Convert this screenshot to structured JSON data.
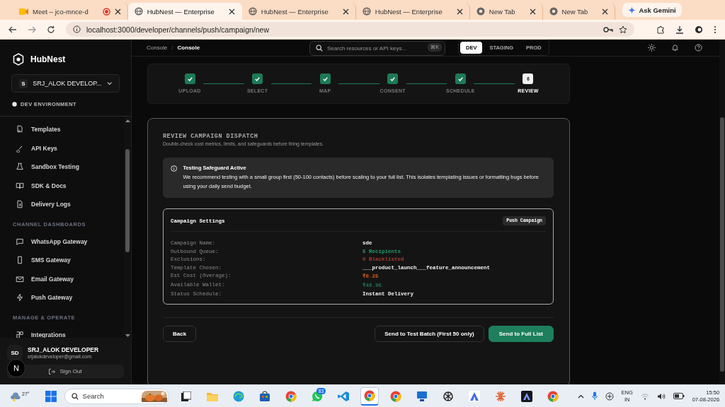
{
  "browser": {
    "tabs": [
      {
        "title": "Meet – jco-mnce-d",
        "kind": "meet",
        "recording": true,
        "selected": false
      },
      {
        "title": "HubNest — Enterprise",
        "kind": "page",
        "recording": false,
        "selected": true
      },
      {
        "title": "HubNest — Enterprise",
        "kind": "page",
        "recording": false,
        "selected": false
      },
      {
        "title": "HubNest — Enterprise",
        "kind": "page",
        "recording": false,
        "selected": false
      },
      {
        "title": "New Tab",
        "kind": "newtab",
        "recording": false,
        "selected": false
      },
      {
        "title": "New Tab",
        "kind": "newtab",
        "recording": false,
        "selected": false
      }
    ],
    "gemini": "Ask Gemini",
    "url": "localhost:3000/developer/channels/push/campaign/new"
  },
  "sidebar": {
    "brand": "HubNest",
    "workspace": {
      "initial": "S",
      "name": "SRJ_ALOK DEVELOP..."
    },
    "environment": "DEV ENVIRONMENT",
    "sections": [
      {
        "items": [
          {
            "label": "Templates"
          },
          {
            "label": "API Keys"
          },
          {
            "label": "Sandbox Testing"
          },
          {
            "label": "SDK & Docs"
          },
          {
            "label": "Delivery Logs"
          }
        ]
      },
      {
        "heading": "CHANNEL DASHBOARDS",
        "items": [
          {
            "label": "WhatsApp Gateway"
          },
          {
            "label": "SMS Gateway"
          },
          {
            "label": "Email Gateway"
          },
          {
            "label": "Push Gateway"
          }
        ]
      },
      {
        "heading": "MANAGE & OPERATE",
        "items": [
          {
            "label": "Integrations"
          }
        ]
      }
    ],
    "user": {
      "initials": "SD",
      "name": "SRJ_ALOK DEVELOPER",
      "email": "srjalokdeveloper@gmail.com"
    },
    "sign_out": "Sign Out",
    "dev_badge": "N"
  },
  "header": {
    "breadcrumb": [
      "Console",
      "Console"
    ],
    "breadcrumb_separator": "/",
    "search": {
      "placeholder": "Search resources or API keys...",
      "shortcut": "⌘K"
    },
    "environments": [
      {
        "label": "DEV",
        "selected": true
      },
      {
        "label": "STAGING",
        "selected": false
      },
      {
        "label": "PROD",
        "selected": false
      }
    ]
  },
  "stepper": [
    {
      "label": "UPLOAD",
      "done": true
    },
    {
      "label": "SELECT",
      "done": true
    },
    {
      "label": "MAP",
      "done": true
    },
    {
      "label": "CONSENT",
      "done": true
    },
    {
      "label": "SCHEDULE",
      "done": true
    },
    {
      "label": "REVIEW",
      "done": false,
      "number": "6"
    }
  ],
  "review": {
    "title": "REVIEW CAMPAIGN DISPATCH",
    "subtitle": "Double-check cost metrics, limits, and safeguards before firing templates.",
    "alert": {
      "title": "Testing Safeguard Active",
      "body": "We recommend testing with a small group first (50-100 contacts) before scaling to your full list. This isolates templating issues or formatting bugs before using your daily send budget."
    },
    "settings": {
      "title": "Campaign Settings",
      "badge": "Push Campaign",
      "rows": [
        {
          "label": "Campaign Name:",
          "value": "sde"
        },
        {
          "label": "Outbound Queue:",
          "value": "5 Recipients",
          "color": "#1f9d6a"
        },
        {
          "label": "Exclusions:",
          "value": "0 Blacklisted",
          "color": "#a33a2c"
        },
        {
          "label": "Template Chosen:",
          "value": "___product_launch___feature_announcement"
        },
        {
          "label": "Est Cost (Overage):",
          "value": "₹0.25",
          "color": "#d2601c"
        },
        {
          "label": "Available Wallet:",
          "value": "₹49.95",
          "color": "#1c7a56"
        },
        {
          "label": "Status Schedule:",
          "value": "Instant Delivery"
        }
      ]
    },
    "buttons": {
      "back": "Back",
      "test": "Send to Test Batch (First 50 only)",
      "full": "Send to Full List"
    }
  },
  "taskbar": {
    "weather": "27°",
    "search": "Search",
    "apps": [
      {
        "kind": "taskview",
        "selected": false
      },
      {
        "kind": "explorer",
        "selected": false
      },
      {
        "kind": "edge",
        "selected": false
      },
      {
        "kind": "store",
        "selected": false
      },
      {
        "kind": "chrome",
        "selected": false
      },
      {
        "kind": "whatsapp",
        "selected": false,
        "badge": "83"
      },
      {
        "kind": "vscode",
        "selected": false
      },
      {
        "kind": "chrome",
        "selected": true
      },
      {
        "kind": "chrome",
        "selected": false
      },
      {
        "kind": "monitor",
        "selected": false
      },
      {
        "kind": "knot",
        "selected": false
      },
      {
        "kind": "triangle",
        "selected": false
      },
      {
        "kind": "asterisk",
        "selected": false
      },
      {
        "kind": "dark",
        "selected": false
      },
      {
        "kind": "chrome",
        "selected": false
      }
    ],
    "language": "ENG",
    "region": "IN",
    "time": "15:50",
    "date": "07-08-2026"
  }
}
